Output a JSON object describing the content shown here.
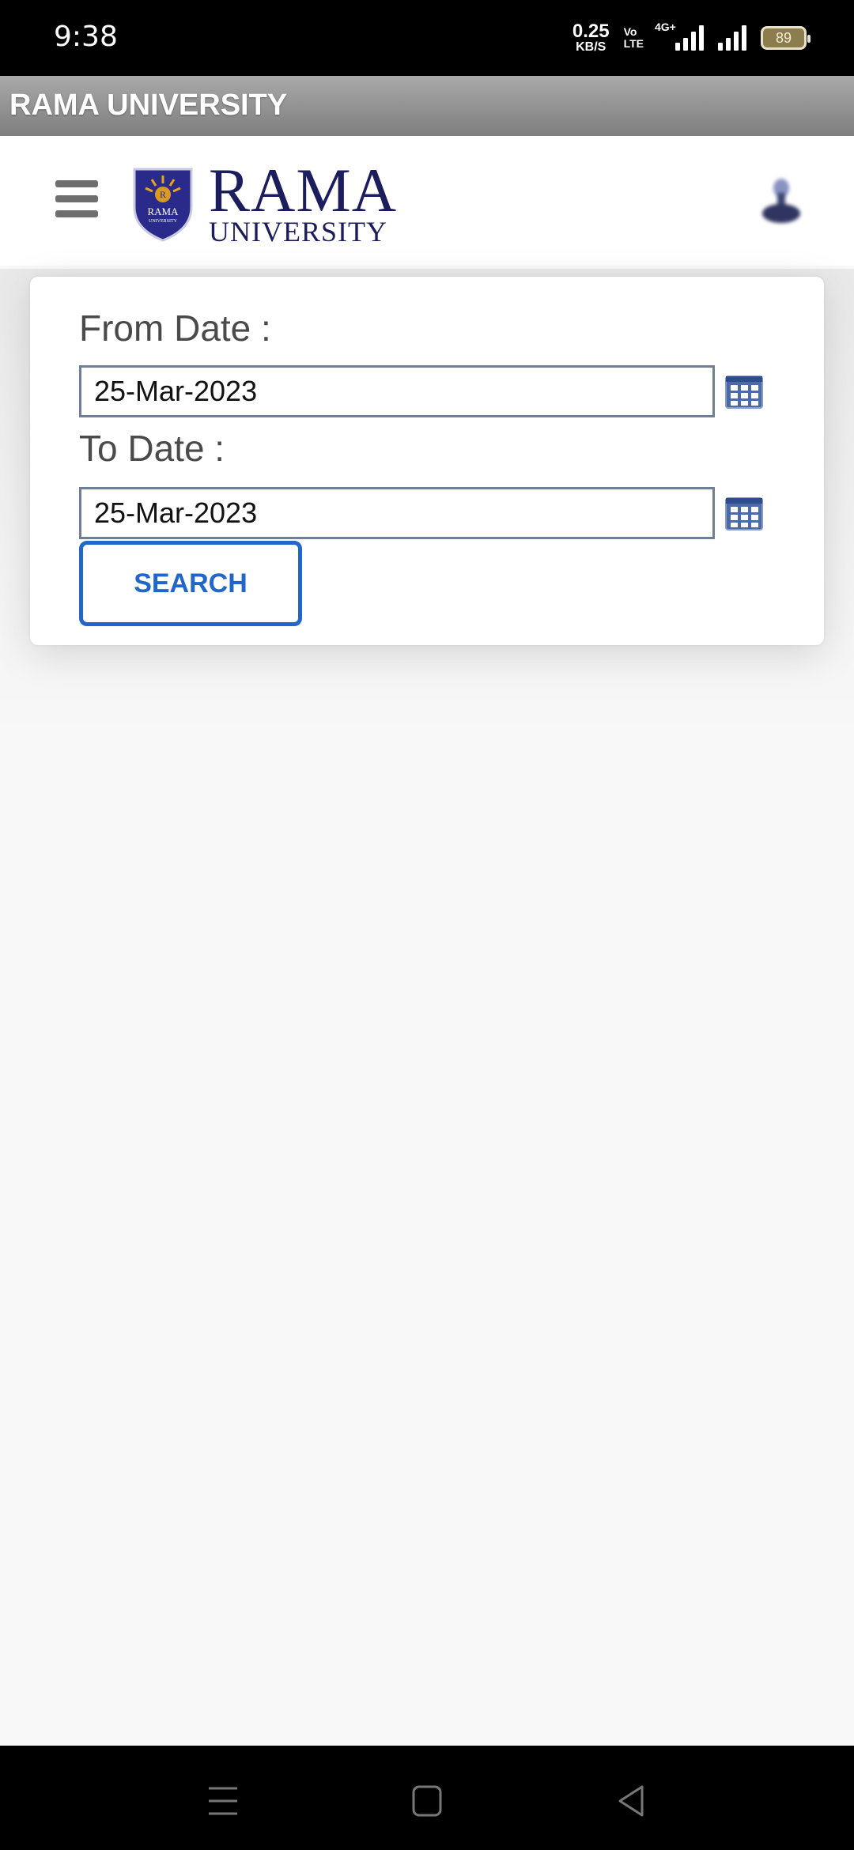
{
  "status_bar": {
    "time": "9:38",
    "net_speed_value": "0.25",
    "net_speed_unit": "KB/S",
    "volte_line1": "Vo",
    "volte_line2": "LTE",
    "network_type": "4G+",
    "battery_level": "89"
  },
  "app": {
    "title": "RAMA UNIVERSITY"
  },
  "header": {
    "logo_line1": "RAMA",
    "logo_line2": "UNIVERSITY",
    "crest_text": "RAMA",
    "crest_subtext": "UNIVERSITY"
  },
  "form": {
    "from_label": "From Date :",
    "from_value": "25-Mar-2023",
    "to_label": "To Date :",
    "to_value": "25-Mar-2023",
    "search_label": "SEARCH"
  },
  "colors": {
    "accent": "#2166c8",
    "logo_navy": "#1c1d5c",
    "title_bar": "#8e8e8e",
    "input_border": "#6f7f98"
  },
  "nav": {
    "recents": "recents-icon",
    "home": "home-icon",
    "back": "back-icon"
  }
}
